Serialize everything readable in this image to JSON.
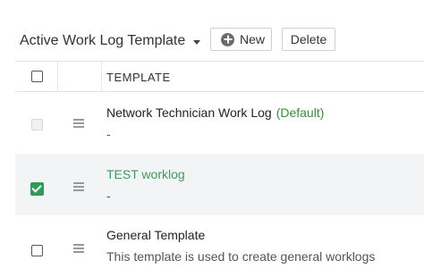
{
  "toolbar": {
    "view_label": "Active Work Log Template",
    "new_label": "New",
    "delete_label": "Delete"
  },
  "table": {
    "header": "TEMPLATE",
    "rows": [
      {
        "name": "Network Technician Work Log",
        "default_badge": "(Default)",
        "description": "-",
        "checked": false,
        "disabled": true
      },
      {
        "name": "TEST worklog",
        "description": "-",
        "checked": true,
        "selected": true
      },
      {
        "name": "General Template",
        "description": "This template is used to create general worklogs",
        "checked": false
      }
    ]
  },
  "colors": {
    "accent_green": "#2e9b56",
    "link_green": "#3c9a5b",
    "selected_row_bg": "#f2f4f6"
  }
}
